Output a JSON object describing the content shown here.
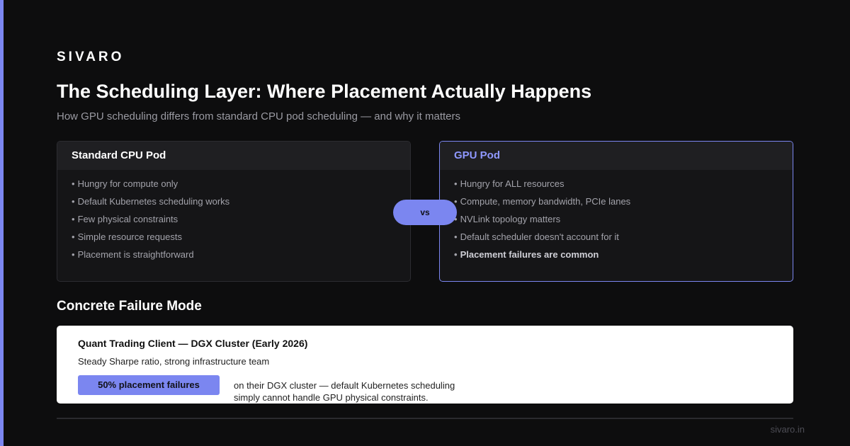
{
  "brand": "SIVARO",
  "title": "The Scheduling Layer: Where Placement Actually Happens",
  "subtitle": "How GPU scheduling differs from standard CPU pod scheduling — and why it matters",
  "colors": {
    "accent": "#7b86f0",
    "background": "#0d0d0e",
    "card": "#151517",
    "card_header": "#1f1f22"
  },
  "cards": {
    "cpu": {
      "title": "Standard CPU Pod",
      "items": [
        "Hungry for compute only",
        "Default Kubernetes scheduling works",
        "Few physical constraints",
        "Simple resource requests",
        "Placement is straightforward"
      ]
    },
    "gpu": {
      "title": "GPU Pod",
      "items": [
        "Hungry for ALL resources",
        "Compute, memory bandwidth, PCIe lanes",
        "NVLink topology matters",
        "Default scheduler doesn't account for it",
        "Placement failures are common"
      ]
    }
  },
  "vs_label": "vs",
  "bullet": "•",
  "failure": {
    "section_title": "Concrete Failure Mode",
    "title": "Quant Trading Client — DGX Cluster (Early 2026)",
    "subtitle": "Steady Sharpe ratio, strong infrastructure team",
    "badge": "50% placement failures",
    "desc_line1": "on their DGX cluster — default Kubernetes scheduling",
    "desc_line2": "simply cannot handle GPU physical constraints."
  },
  "footer": "sivaro.in"
}
